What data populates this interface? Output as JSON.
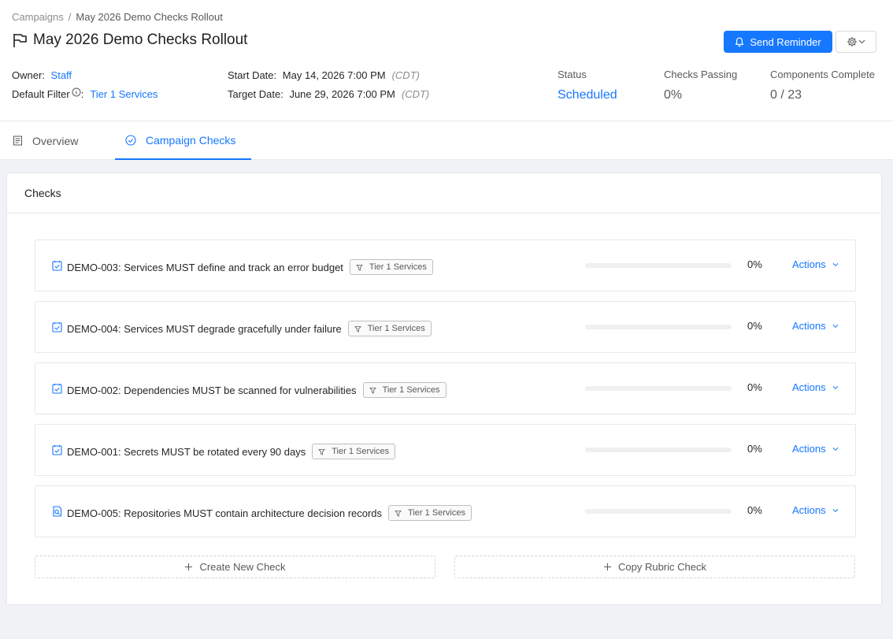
{
  "breadcrumb": {
    "root": "Campaigns",
    "separator": "/",
    "current": "May 2026 Demo Checks Rollout"
  },
  "header": {
    "title": "May 2026 Demo Checks Rollout",
    "title_icon": "flag-icon",
    "send_reminder_label": "Send Reminder",
    "send_reminder_icon": "bell-icon",
    "settings_icon": "gear-icon"
  },
  "meta": {
    "owner_label": "Owner",
    "owner_value": "Staff",
    "default_filter_label": "Default Filter",
    "default_filter_value": "Tier 1 Services",
    "start_date_label": "Start Date",
    "start_date_value": "May 14, 2026 7:00 PM",
    "start_date_tz": "(CDT)",
    "target_date_label": "Target Date",
    "target_date_value": "June 29, 2026 7:00 PM",
    "target_date_tz": "(CDT)",
    "colon": ":"
  },
  "stats": {
    "status_label": "Status",
    "status_value": "Scheduled",
    "checks_passing_label": "Checks Passing",
    "checks_passing_value": "0%",
    "components_complete_label": "Components Complete",
    "components_complete_value": "0 / 23"
  },
  "tabs": [
    {
      "label": "Overview",
      "icon": "document-icon",
      "active": false
    },
    {
      "label": "Campaign Checks",
      "icon": "check-circle-icon",
      "active": true
    }
  ],
  "checks_card": {
    "title": "Checks",
    "items": [
      {
        "name": "DEMO-003: Services MUST define and track an error budget",
        "filter": "Tier 1 Services",
        "progress": 0,
        "percent_label": "0%",
        "actions_label": "Actions",
        "icon": "check-square-icon"
      },
      {
        "name": "DEMO-004: Services MUST degrade gracefully under failure",
        "filter": "Tier 1 Services",
        "progress": 0,
        "percent_label": "0%",
        "actions_label": "Actions",
        "icon": "check-square-icon"
      },
      {
        "name": "DEMO-002: Dependencies MUST be scanned for vulnerabilities",
        "filter": "Tier 1 Services",
        "progress": 0,
        "percent_label": "0%",
        "actions_label": "Actions",
        "icon": "check-square-icon"
      },
      {
        "name": "DEMO-001: Secrets MUST be rotated every 90 days",
        "filter": "Tier 1 Services",
        "progress": 0,
        "percent_label": "0%",
        "actions_label": "Actions",
        "icon": "check-square-icon"
      },
      {
        "name": "DEMO-005: Repositories MUST contain architecture decision records",
        "filter": "Tier 1 Services",
        "progress": 0,
        "percent_label": "0%",
        "actions_label": "Actions",
        "icon": "document-search-icon"
      }
    ],
    "create_new_label": "Create New Check",
    "copy_rubric_label": "Copy Rubric Check"
  },
  "colors": {
    "accent": "#1677ff",
    "text": "#262626",
    "muted": "#8c8c8c",
    "border": "#e8e8e8",
    "background": "#f0f2f5"
  }
}
